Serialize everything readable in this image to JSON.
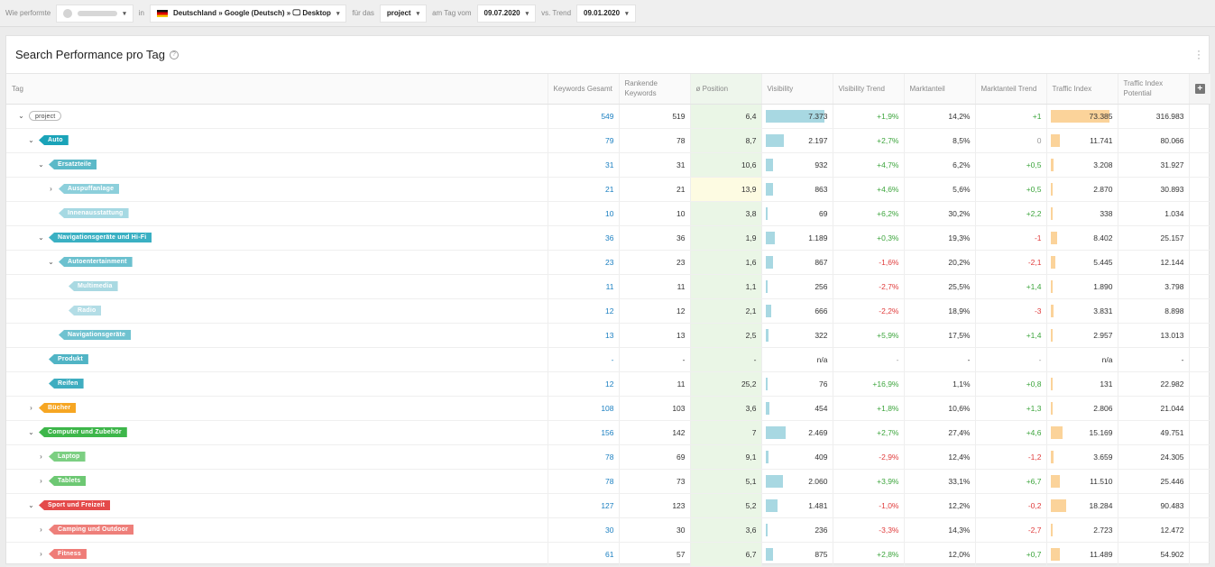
{
  "topbar": {
    "label_wie": "Wie performte",
    "domain_value": "amazon.de",
    "label_in": "in",
    "location": "Deutschland » Google (Deutsch) » ",
    "device": "Desktop",
    "label_fuer": "für das",
    "project": "project",
    "label_am_tag": "am Tag vom",
    "date": "09.07.2020",
    "label_trend": "vs. Trend",
    "trend_date": "09.01.2020"
  },
  "card": {
    "title": "Search Performance pro Tag"
  },
  "columns": {
    "tag": "Tag",
    "keywords_gesamt": "Keywords Gesamt",
    "rankende_keywords": "Rankende Keywords",
    "position": "ø Position",
    "visibility": "Visibility",
    "visibility_trend": "Visibility Trend",
    "marktanteil": "Marktanteil",
    "marktanteil_trend": "Marktanteil Trend",
    "traffic_index": "Traffic Index",
    "traffic_index_potential": "Traffic Index Potential"
  },
  "colors": {
    "root": "#ffffff",
    "auto": "#1aa3b8",
    "ersatzteile": "#5cb9c8",
    "auspuffanlage": "#8ccfdb",
    "innenausstattung": "#a6d9e3",
    "navi_hifi": "#3ab0c3",
    "autoentertainment": "#6cc1cf",
    "multimedia": "#a9d9e2",
    "radio": "#b3dde6",
    "navigationsgeraete": "#6fc2d0",
    "produkt": "#50b4c5",
    "reifen": "#3fadc0",
    "buecher": "#f6a623",
    "computer": "#3db64a",
    "laptop": "#7ccf82",
    "tablets": "#6dc873",
    "sport": "#e44a4a",
    "camping": "#ee7f7a",
    "fitness": "#ef7c78"
  },
  "rows": [
    {
      "tag": "project",
      "kw": "549",
      "rk": "519",
      "pos": "6,4",
      "vis": "7.373",
      "vis_frac": 0.97,
      "vt": "+1,9%",
      "vt_class": "pos-green",
      "ma": "14,2%",
      "mt": "+1",
      "mt_class": "pos-green",
      "ti": "73.385",
      "ti_frac": 0.97,
      "tip": "316.983"
    },
    {
      "tag": "Auto",
      "kw": "79",
      "rk": "78",
      "pos": "8,7",
      "vis": "2.197",
      "vis_frac": 0.3,
      "vt": "+2,7%",
      "vt_class": "pos-green",
      "ma": "8,5%",
      "mt": "0",
      "mt_class": "neutral",
      "ti": "11.741",
      "ti_frac": 0.16,
      "tip": "80.066"
    },
    {
      "tag": "Ersatzteile",
      "kw": "31",
      "rk": "31",
      "pos": "10,6",
      "vis": "932",
      "vis_frac": 0.13,
      "vt": "+4,7%",
      "vt_class": "pos-green",
      "ma": "6,2%",
      "mt": "+0,5",
      "mt_class": "pos-green",
      "ti": "3.208",
      "ti_frac": 0.045,
      "tip": "31.927"
    },
    {
      "tag": "Auspuffanlage",
      "kw": "21",
      "rk": "21",
      "pos": "13,9",
      "vis": "863",
      "vis_frac": 0.12,
      "vt": "+4,6%",
      "vt_class": "pos-green",
      "ma": "5,6%",
      "mt": "+0,5",
      "mt_class": "pos-green",
      "ti": "2.870",
      "ti_frac": 0.04,
      "tip": "30.893"
    },
    {
      "tag": "Innenausstattung",
      "kw": "10",
      "rk": "10",
      "pos": "3,8",
      "vis": "69",
      "vis_frac": 0.01,
      "vt": "+6,2%",
      "vt_class": "pos-green",
      "ma": "30,2%",
      "mt": "+2,2",
      "mt_class": "pos-green",
      "ti": "338",
      "ti_frac": 0.006,
      "tip": "1.034"
    },
    {
      "tag": "Navigationsgeräte und Hi-Fi",
      "kw": "36",
      "rk": "36",
      "pos": "1,9",
      "vis": "1.189",
      "vis_frac": 0.16,
      "vt": "+0,3%",
      "vt_class": "pos-green",
      "ma": "19,3%",
      "mt": "-1",
      "mt_class": "neg-red",
      "ti": "8.402",
      "ti_frac": 0.115,
      "tip": "25.157"
    },
    {
      "tag": "Autoentertainment",
      "kw": "23",
      "rk": "23",
      "pos": "1,6",
      "vis": "867",
      "vis_frac": 0.12,
      "vt": "-1,6%",
      "vt_class": "neg-red",
      "ma": "20,2%",
      "mt": "-2,1",
      "mt_class": "neg-red",
      "ti": "5.445",
      "ti_frac": 0.075,
      "tip": "12.144"
    },
    {
      "tag": "Multimedia",
      "kw": "11",
      "rk": "11",
      "pos": "1,1",
      "vis": "256",
      "vis_frac": 0.035,
      "vt": "-2,7%",
      "vt_class": "neg-red",
      "ma": "25,5%",
      "mt": "+1,4",
      "mt_class": "pos-green",
      "ti": "1.890",
      "ti_frac": 0.026,
      "tip": "3.798"
    },
    {
      "tag": "Radio",
      "kw": "12",
      "rk": "12",
      "pos": "2,1",
      "vis": "666",
      "vis_frac": 0.09,
      "vt": "-2,2%",
      "vt_class": "neg-red",
      "ma": "18,9%",
      "mt": "-3",
      "mt_class": "neg-red",
      "ti": "3.831",
      "ti_frac": 0.052,
      "tip": "8.898"
    },
    {
      "tag": "Navigationsgeräte",
      "kw": "13",
      "rk": "13",
      "pos": "2,5",
      "vis": "322",
      "vis_frac": 0.045,
      "vt": "+5,9%",
      "vt_class": "pos-green",
      "ma": "17,5%",
      "mt": "+1,4",
      "mt_class": "pos-green",
      "ti": "2.957",
      "ti_frac": 0.04,
      "tip": "13.013"
    },
    {
      "tag": "Produkt",
      "kw": "-",
      "rk": "-",
      "pos": "-",
      "vis": "n/a",
      "vis_frac": 0,
      "vt": "-",
      "vt_class": "neutral",
      "ma": "-",
      "mt": "-",
      "mt_class": "neutral",
      "ti": "n/a",
      "ti_frac": 0,
      "tip": "-"
    },
    {
      "tag": "Reifen",
      "kw": "12",
      "rk": "11",
      "pos": "25,2",
      "vis": "76",
      "vis_frac": 0.01,
      "vt": "+16,9%",
      "vt_class": "pos-green",
      "ma": "1,1%",
      "mt": "+0,8",
      "mt_class": "pos-green",
      "ti": "131",
      "ti_frac": 0.003,
      "tip": "22.982"
    },
    {
      "tag": "Bücher",
      "kw": "108",
      "rk": "103",
      "pos": "3,6",
      "vis": "454",
      "vis_frac": 0.062,
      "vt": "+1,8%",
      "vt_class": "pos-green",
      "ma": "10,6%",
      "mt": "+1,3",
      "mt_class": "pos-green",
      "ti": "2.806",
      "ti_frac": 0.038,
      "tip": "21.044"
    },
    {
      "tag": "Computer und Zubehör",
      "kw": "156",
      "rk": "142",
      "pos": "7",
      "vis": "2.469",
      "vis_frac": 0.335,
      "vt": "+2,7%",
      "vt_class": "pos-green",
      "ma": "27,4%",
      "mt": "+4,6",
      "mt_class": "pos-green",
      "ti": "15.169",
      "ti_frac": 0.205,
      "tip": "49.751"
    },
    {
      "tag": "Laptop",
      "kw": "78",
      "rk": "69",
      "pos": "9,1",
      "vis": "409",
      "vis_frac": 0.056,
      "vt": "-2,9%",
      "vt_class": "neg-red",
      "ma": "12,4%",
      "mt": "-1,2",
      "mt_class": "neg-red",
      "ti": "3.659",
      "ti_frac": 0.05,
      "tip": "24.305"
    },
    {
      "tag": "Tablets",
      "kw": "78",
      "rk": "73",
      "pos": "5,1",
      "vis": "2.060",
      "vis_frac": 0.28,
      "vt": "+3,9%",
      "vt_class": "pos-green",
      "ma": "33,1%",
      "mt": "+6,7",
      "mt_class": "pos-green",
      "ti": "11.510",
      "ti_frac": 0.157,
      "tip": "25.446"
    },
    {
      "tag": "Sport und Freizeit",
      "kw": "127",
      "rk": "123",
      "pos": "5,2",
      "vis": "1.481",
      "vis_frac": 0.2,
      "vt": "-1,0%",
      "vt_class": "neg-red",
      "ma": "12,2%",
      "mt": "-0,2",
      "mt_class": "neg-red",
      "ti": "18.284",
      "ti_frac": 0.25,
      "tip": "90.483"
    },
    {
      "tag": "Camping und Outdoor",
      "kw": "30",
      "rk": "30",
      "pos": "3,6",
      "vis": "236",
      "vis_frac": 0.032,
      "vt": "-3,3%",
      "vt_class": "neg-red",
      "ma": "14,3%",
      "mt": "-2,7",
      "mt_class": "neg-red",
      "ti": "2.723",
      "ti_frac": 0.037,
      "tip": "12.472"
    },
    {
      "tag": "Fitness",
      "kw": "61",
      "rk": "57",
      "pos": "6,7",
      "vis": "875",
      "vis_frac": 0.12,
      "vt": "+2,8%",
      "vt_class": "pos-green",
      "ma": "12,0%",
      "mt": "+0,7",
      "mt_class": "pos-green",
      "ti": "11.489",
      "ti_frac": 0.157,
      "tip": "54.902"
    }
  ]
}
